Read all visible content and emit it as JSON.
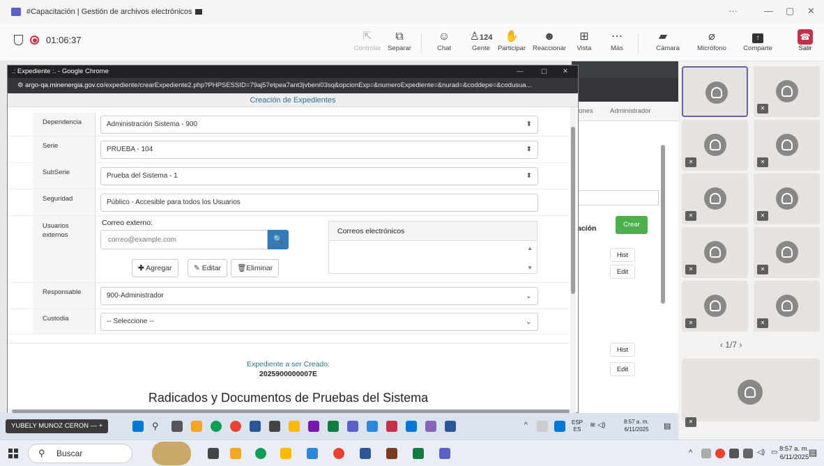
{
  "window": {
    "title": "#Capacitación | Gestión de archivos electrónicos"
  },
  "meeting": {
    "timer": "01:06:37",
    "toolbar": [
      {
        "label": "Controlar",
        "icon": "control-icon",
        "disabled": true
      },
      {
        "label": "Separar",
        "icon": "popout-icon"
      },
      {
        "label": "Chat",
        "icon": "chat-icon"
      },
      {
        "label": "Gente",
        "icon": "people-icon",
        "count": "124"
      },
      {
        "label": "Participar",
        "icon": "raise-hand-icon"
      },
      {
        "label": "Reaccionar",
        "icon": "reaction-icon"
      },
      {
        "label": "Vista",
        "icon": "view-icon"
      },
      {
        "label": "Más",
        "icon": "more-icon"
      },
      {
        "label": "Cámara",
        "icon": "camera-off-icon"
      },
      {
        "label": "Micrófono",
        "icon": "mic-off-icon"
      },
      {
        "label": "Comparte",
        "icon": "share-icon"
      },
      {
        "label": "Salir",
        "icon": "leave-icon"
      }
    ],
    "leave_color": "#c4314b"
  },
  "chrome": {
    "title": ".: Expediente :. - Google Chrome",
    "url_host": "argo-qa.minenergia.gov.co",
    "url_path": "/expediente/crearExpediente2.php?PHPSESSID=79aj57etpea7ant3jvbeni03sq&opcionExp=&numeroExpediente=&nurad=&coddepe=&codusua..."
  },
  "form": {
    "heading": "Creación de Expedientes",
    "dependencia": {
      "label": "Dependencia",
      "value": "Administración Sistema - 900"
    },
    "serie": {
      "label": "Serie",
      "value": "PRUEBA - 104"
    },
    "subserie": {
      "label": "SubSerie",
      "value": "Prueba del Sistema - 1"
    },
    "seguridad": {
      "label": "Seguridad",
      "value": "Público - Accesible para todos los Usuarios"
    },
    "usuarios": {
      "label": "Usuarios externos",
      "email_label": "Correo externo:",
      "email_placeholder": "correo@example.com",
      "add_label": "Agregar",
      "edit_label": "Editar",
      "delete_label": "Eliminar",
      "list_heading": "Correos electrónicos"
    },
    "responsable": {
      "label": "Responsable",
      "value": "900-Administrador"
    },
    "custodia": {
      "label": "Custodia",
      "value": "-- Seleccione --"
    },
    "preview_label": "Expediente a ser Creado:",
    "preview_number": "2025900000007E",
    "section_heading": "Radicados y Documentos de Pruebas del Sistema"
  },
  "background_app": {
    "menu1": "iones",
    "menu2": "Administrador",
    "column": "ación",
    "create": "Crear",
    "hist": "Hist",
    "edit": "Edit"
  },
  "participants": {
    "page": "1/7"
  },
  "inner_taskbar": {
    "presenter": "YUBELY MUNOZ CERON",
    "lang": "ESP",
    "lang2": "ES",
    "time": "8:57 a. m.",
    "date": "6/11/2025"
  },
  "taskbar": {
    "search": "Buscar",
    "time": "8:57 a. m.",
    "date": "6/11/2025"
  }
}
